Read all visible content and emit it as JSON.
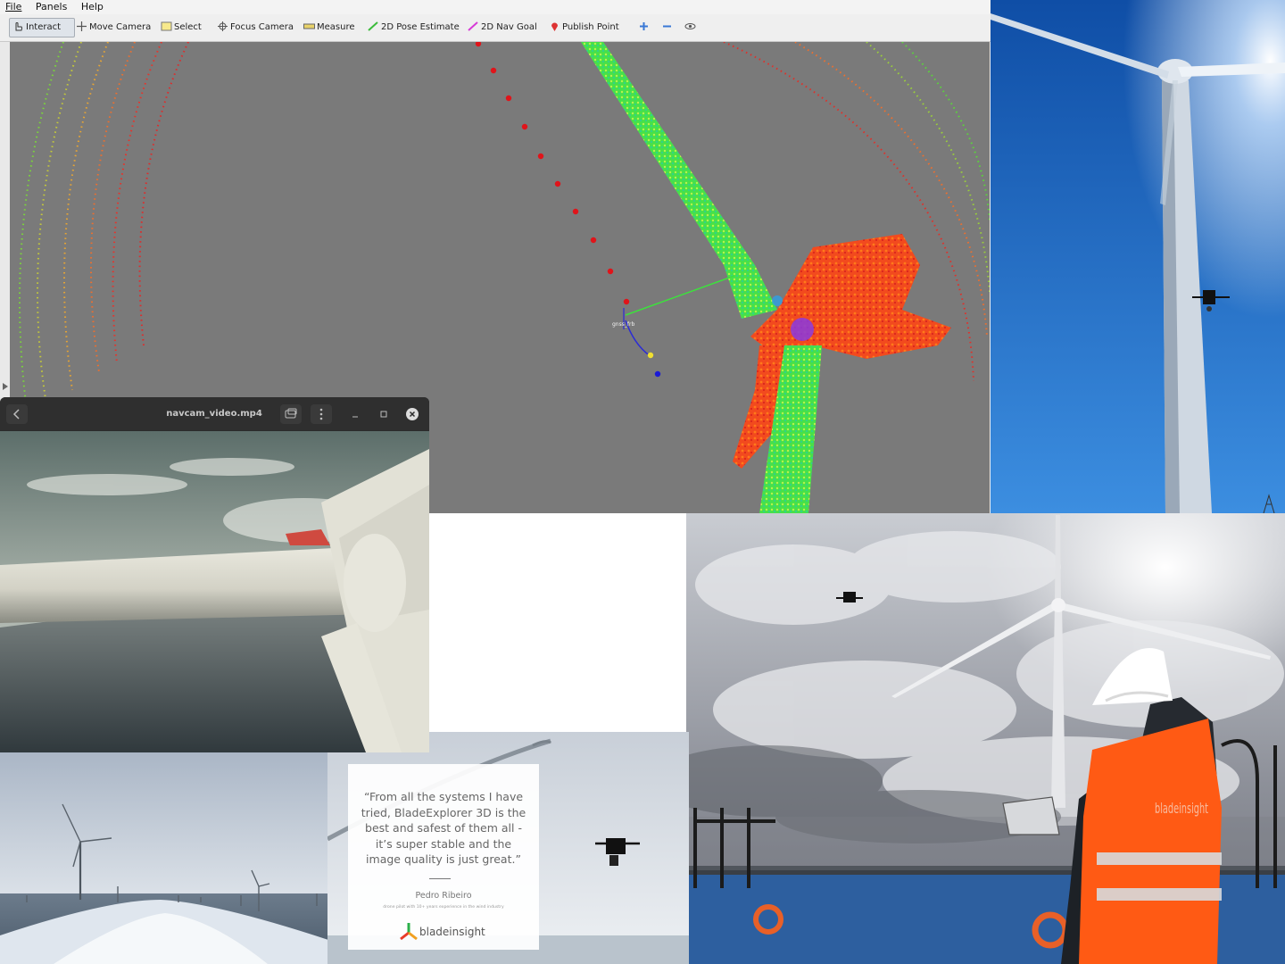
{
  "menubar": {
    "items": [
      "File",
      "Panels",
      "Help"
    ]
  },
  "toolbar": {
    "interact": "Interact",
    "move_camera": "Move Camera",
    "select": "Select",
    "focus_camera": "Focus Camera",
    "measure": "Measure",
    "pose_estimate": "2D Pose Estimate",
    "nav_goal": "2D Nav Goal",
    "publish_point": "Publish Point"
  },
  "viewport": {
    "frame_label": "gnss_frb"
  },
  "player": {
    "title": "navcam_video.mp4"
  },
  "testimonial": {
    "quote_line1": "“From all the systems I have",
    "quote_line2": "tried, BladeExplorer 3D is the",
    "quote_line3": "best and safest of them all -",
    "quote_line4": "it’s super stable and the",
    "quote_line5": "image quality is just great.”",
    "author": "Pedro Ribeiro",
    "role": "drone pilot with 10+ years experience in the wind industry",
    "brand": "bladeinsight"
  },
  "vest_text": "bladeinsight",
  "colors": {
    "viewport_bg": "#7a7a7a",
    "sky_blue": "#1f63b5",
    "vest_orange": "#ff5a14"
  }
}
